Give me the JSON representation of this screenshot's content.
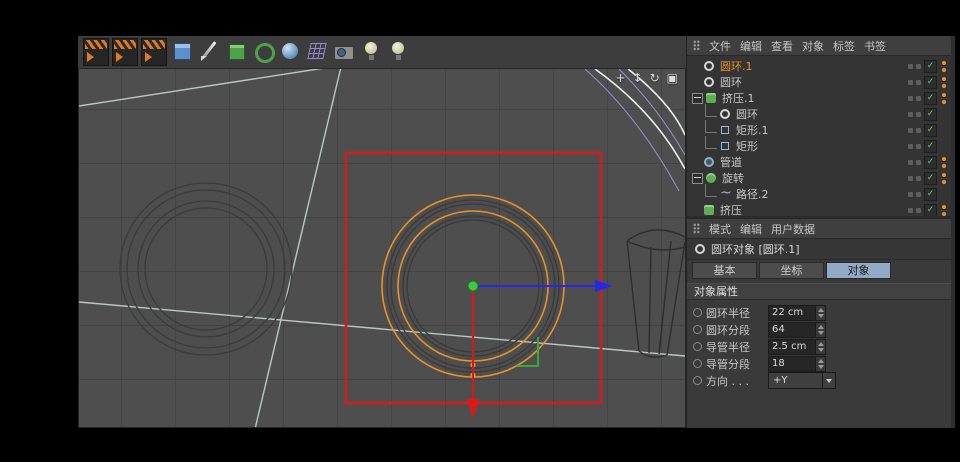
{
  "colors": {
    "accent_orange": "#e8922a",
    "selection_red": "#ce1e1e",
    "axis_blue": "#2727e8",
    "axis_red": "#e01616",
    "axis_green": "#3ecb3e",
    "check_green": "#5ecf5e",
    "tab_active": "#93aac6"
  },
  "toolbar": {
    "icons": [
      {
        "name": "render-view-icon",
        "cls": "i-clapper"
      },
      {
        "name": "render-picture-viewer-icon",
        "cls": "i-clapper"
      },
      {
        "name": "render-settings-icon",
        "cls": "i-clapper"
      },
      {
        "name": "add-cube-icon",
        "cls": "i-cube"
      },
      {
        "name": "pen-spline-icon",
        "cls": "i-pen"
      },
      {
        "name": "generator-cube-icon",
        "cls": "i-greencube"
      },
      {
        "name": "array-generator-icon",
        "cls": "i-rings"
      },
      {
        "name": "metaball-icon",
        "cls": "i-ball"
      },
      {
        "name": "deformer-grid-icon",
        "cls": "i-grid"
      },
      {
        "name": "camera-icon",
        "cls": "i-camera"
      },
      {
        "name": "light-icon",
        "cls": "i-light"
      },
      {
        "name": "spot-light-icon",
        "cls": "i-light"
      }
    ]
  },
  "viewport": {
    "controls": [
      {
        "name": "pan-view-icon",
        "glyph": "+"
      },
      {
        "name": "zoom-view-icon",
        "glyph": "↕"
      },
      {
        "name": "rotate-view-icon",
        "glyph": "↻"
      },
      {
        "name": "maximize-view-icon",
        "glyph": "▣"
      }
    ]
  },
  "object_manager": {
    "menu": [
      "文件",
      "编辑",
      "查看",
      "对象",
      "标签",
      "书签"
    ],
    "rows": [
      {
        "label": "圆环.1",
        "depth": 0,
        "icon": "ring",
        "selected": true,
        "expander": false,
        "dots": true
      },
      {
        "label": "圆环",
        "depth": 0,
        "icon": "ring",
        "selected": false,
        "expander": false,
        "dots": true
      },
      {
        "label": "挤压.1",
        "depth": 0,
        "icon": "extrude",
        "selected": false,
        "expander": true,
        "dots": true
      },
      {
        "label": "圆环",
        "depth": 1,
        "icon": "ring",
        "selected": false,
        "expander": false,
        "dots": false
      },
      {
        "label": "矩形.1",
        "depth": 1,
        "icon": "rect",
        "selected": false,
        "expander": false,
        "dots": false
      },
      {
        "label": "矩形",
        "depth": 1,
        "icon": "rect",
        "selected": false,
        "expander": false,
        "dots": false
      },
      {
        "label": "管道",
        "depth": 0,
        "icon": "tube",
        "selected": false,
        "expander": false,
        "dots": true
      },
      {
        "label": "旋转",
        "depth": 0,
        "icon": "lathe",
        "selected": false,
        "expander": true,
        "dots": true
      },
      {
        "label": "路径.2",
        "depth": 1,
        "icon": "spline",
        "selected": false,
        "expander": false,
        "dots": false
      },
      {
        "label": "挤压",
        "depth": 0,
        "icon": "extrude",
        "selected": false,
        "expander": false,
        "dots": true
      }
    ]
  },
  "attribute_manager": {
    "menu": [
      "模式",
      "编辑",
      "用户数据"
    ],
    "title": "圆环对象 [圆环.1]",
    "tabs": [
      "基本",
      "坐标",
      "对象"
    ],
    "active_tab": "对象",
    "section": "对象属性",
    "properties": [
      {
        "label": "圆环半径",
        "value": "22 cm",
        "control": "stepper"
      },
      {
        "label": "圆环分段",
        "value": "64",
        "control": "stepper"
      },
      {
        "label": "导管半径",
        "value": "2.5 cm",
        "control": "stepper"
      },
      {
        "label": "导管分段",
        "value": "18",
        "control": "stepper"
      },
      {
        "label": "方向 . . .",
        "value": "+Y",
        "control": "dropdown"
      }
    ]
  }
}
